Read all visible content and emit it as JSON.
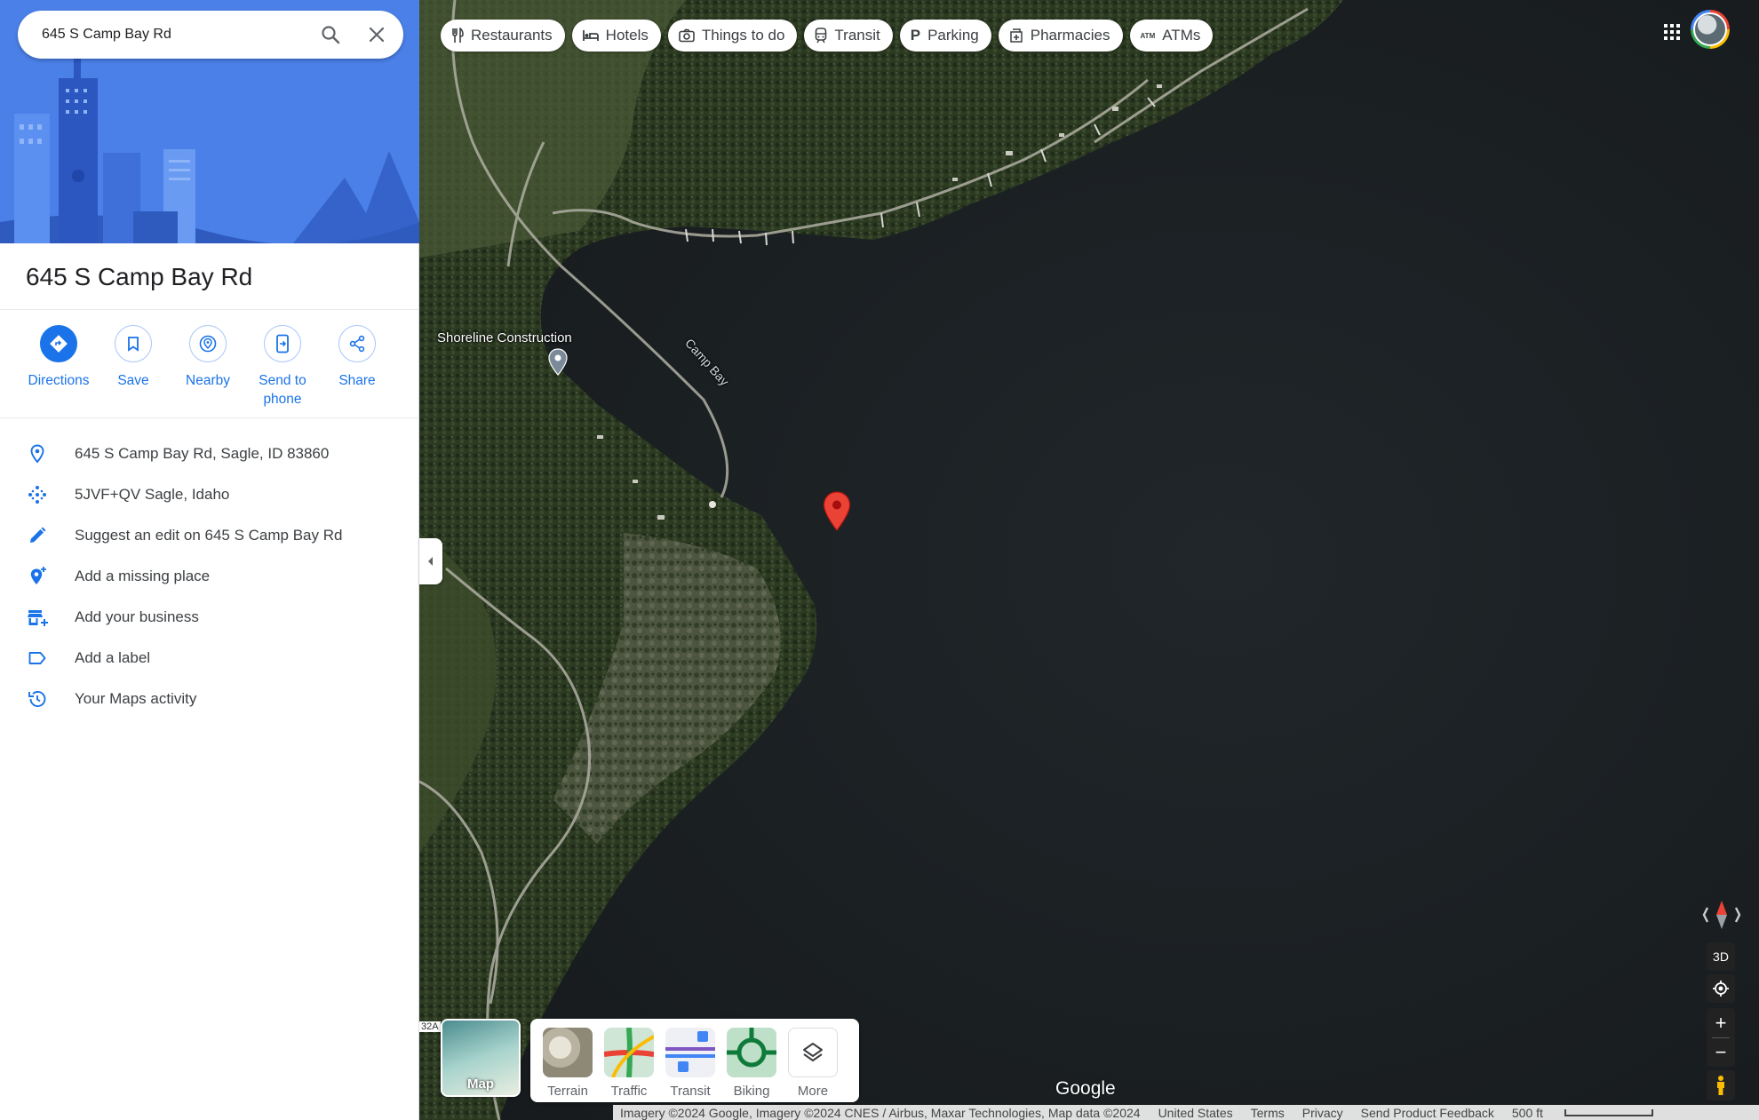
{
  "search": {
    "query": "645 S Camp Bay Rd"
  },
  "place": {
    "title": "645 S Camp Bay Rd"
  },
  "actions": [
    {
      "label": "Directions"
    },
    {
      "label": "Save"
    },
    {
      "label": "Nearby"
    },
    {
      "label": "Send to\nphone"
    },
    {
      "label": "Share"
    }
  ],
  "info": [
    {
      "text": "645 S Camp Bay Rd, Sagle, ID 83860",
      "icon": "location-pin-icon"
    },
    {
      "text": "5JVF+QV Sagle, Idaho",
      "icon": "plus-code-icon"
    },
    {
      "text": "Suggest an edit on 645 S Camp Bay Rd",
      "icon": "pencil-icon"
    },
    {
      "text": "Add a missing place",
      "icon": "add-location-icon"
    },
    {
      "text": "Add your business",
      "icon": "add-business-icon"
    },
    {
      "text": "Add a label",
      "icon": "label-icon"
    },
    {
      "text": "Your Maps activity",
      "icon": "history-icon"
    }
  ],
  "chips": [
    {
      "label": "Restaurants",
      "icon": "fork-knife-icon"
    },
    {
      "label": "Hotels",
      "icon": "bed-icon"
    },
    {
      "label": "Things to do",
      "icon": "camera-icon"
    },
    {
      "label": "Transit",
      "icon": "train-icon"
    },
    {
      "label": "Parking",
      "icon": "parking-icon"
    },
    {
      "label": "Pharmacies",
      "icon": "pharmacy-icon"
    },
    {
      "label": "ATMs",
      "icon": "atm-icon"
    }
  ],
  "map": {
    "labels": {
      "shoreline": "Shoreline Construction",
      "camp_bay": "Camp Bay",
      "road_marker": "32A"
    },
    "layer_map_label": "Map",
    "layers": [
      {
        "label": "Terrain"
      },
      {
        "label": "Traffic"
      },
      {
        "label": "Transit"
      },
      {
        "label": "Biking"
      },
      {
        "label": "More"
      }
    ],
    "controls": {
      "three_d": "3D",
      "zoom_in": "+",
      "zoom_out": "−"
    },
    "logo": "Google"
  },
  "footer": {
    "attribution": "Imagery ©2024 Google, Imagery ©2024 CNES / Airbus, Maxar Technologies, Map data ©2024",
    "country": "United States",
    "terms": "Terms",
    "privacy": "Privacy",
    "feedback": "Send Product Feedback",
    "scale": "500 ft"
  },
  "colors": {
    "accent": "#1a73e8",
    "marker": "#ea4335",
    "water": "#1d2124"
  }
}
